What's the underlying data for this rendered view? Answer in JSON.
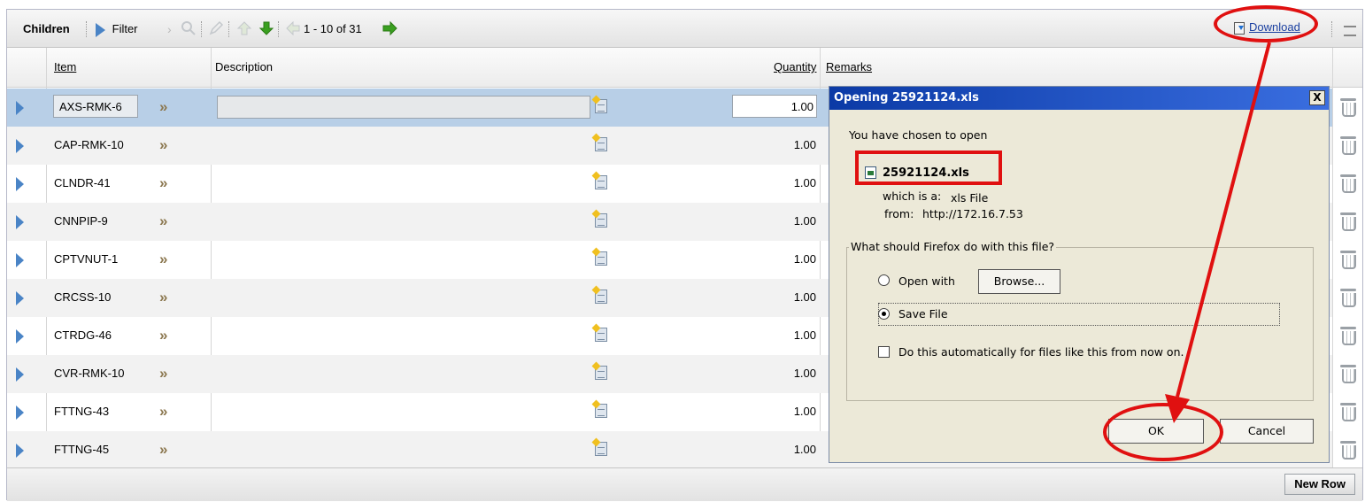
{
  "toolbar": {
    "title": "Children",
    "filter_label": "Filter",
    "pagination": "1 - 10 of 31",
    "download_label": "Download"
  },
  "columns": {
    "item": "Item",
    "description": "Description",
    "quantity": "Quantity",
    "remarks": "Remarks"
  },
  "rows": [
    {
      "item": "AXS-RMK-6",
      "quantity": "1.00"
    },
    {
      "item": "CAP-RMK-10",
      "quantity": "1.00"
    },
    {
      "item": "CLNDR-41",
      "quantity": "1.00"
    },
    {
      "item": "CNNPIP-9",
      "quantity": "1.00"
    },
    {
      "item": "CPTVNUT-1",
      "quantity": "1.00"
    },
    {
      "item": "CRCSS-10",
      "quantity": "1.00"
    },
    {
      "item": "CTRDG-46",
      "quantity": "1.00"
    },
    {
      "item": "CVR-RMK-10",
      "quantity": "1.00"
    },
    {
      "item": "FTTNG-43",
      "quantity": "1.00"
    },
    {
      "item": "FTTNG-45",
      "quantity": "1.00"
    }
  ],
  "footer": {
    "new_row_label": "New Row"
  },
  "dialog": {
    "title": "Opening 25921124.xls",
    "close": "X",
    "chosen_text": "You have chosen to open",
    "filename": "25921124.xls",
    "type_label": "which is a:",
    "type_value": "xls File",
    "from_label": "from:",
    "from_value": "http://172.16.7.53",
    "question": "What should Firefox do with this file?",
    "open_with": "Open with",
    "browse": "Browse...",
    "save_file": "Save File",
    "auto_text": "Do this automatically for files like this from now on.",
    "ok": "OK",
    "cancel": "Cancel",
    "selected_option": "Save File",
    "auto_checked": false
  },
  "colors": {
    "selected_row": "#b8cfe7",
    "dialog_title": "#0b3aa6",
    "annotation": "#e01010",
    "arrow_blue": "#4a84c6",
    "arrow_green": "#3aa020"
  }
}
